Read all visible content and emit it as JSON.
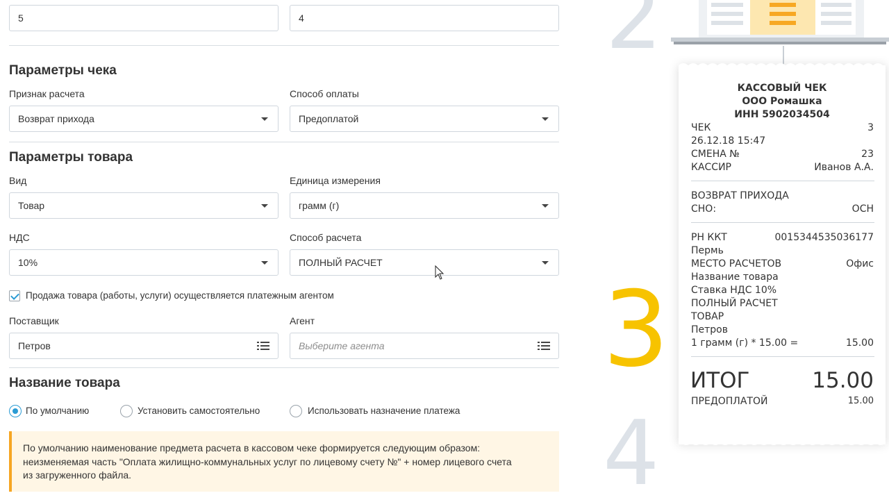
{
  "top_inputs": {
    "left_value": "5",
    "right_value": "4"
  },
  "receipt_params": {
    "heading": "Параметры чека",
    "calc_sign_label": "Признак расчета",
    "calc_sign_value": "Возврат прихода",
    "payment_method_label": "Способ оплаты",
    "payment_method_value": "Предоплатой"
  },
  "product_params": {
    "heading": "Параметры товара",
    "kind_label": "Вид",
    "kind_value": "Товар",
    "unit_label": "Единица измерения",
    "unit_value": "грамм (г)",
    "vat_label": "НДС",
    "vat_value": "10%",
    "calc_method_label": "Способ расчета",
    "calc_method_value": "ПОЛНЫЙ РАСЧЕТ",
    "agent_checkbox_label": "Продажа товара (работы, услуги) осуществляется платежным агентом",
    "supplier_label": "Поставщик",
    "supplier_value": "Петров",
    "agent_label": "Агент",
    "agent_placeholder": "Выберите агента"
  },
  "product_name": {
    "heading": "Название товара",
    "options": [
      "По умолчанию",
      "Установить самостоятельно",
      "Использовать назначение платежа"
    ],
    "selected": "По умолчанию",
    "info_lines": [
      "По умолчанию наименование предмета расчета в кассовом чеке формируется следующим образом:",
      "неизменяемая часть \"Оплата жилищно-коммунальных услуг по лицевому счету №\" + номер лицевого счета",
      "из загруженного файла."
    ]
  },
  "steps": {
    "step2": "2",
    "step3": "3",
    "step4": "4"
  },
  "receipt": {
    "title": "КАССОВЫЙ ЧЕК",
    "company": "ООО Ромашка",
    "inn": "ИНН 5902034504",
    "check_label": "ЧЕК",
    "check_value": "3",
    "datetime": "26.12.18 15:47",
    "shift_label": "СМЕНА №",
    "shift_value": "23",
    "cashier_label": "КАССИР",
    "cashier_value": "Иванов А.А.",
    "operation": "ВОЗВРАТ ПРИХОДА",
    "tax_label": "СНО:",
    "tax_value": "ОСН",
    "kkt_label": "РН ККТ",
    "kkt_value": "0015344535036177",
    "city": "Пермь",
    "place_label": "МЕСТО РАСЧЕТОВ",
    "place_value": "Офис",
    "item_name": "Название товара",
    "vat_rate": "Ставка НДС 10%",
    "calc_method": "ПОЛНЫЙ РАСЧЕТ",
    "subject": "ТОВАР",
    "supplier": "Петров",
    "line_calc": "1 грамм (г) * 15.00 =",
    "line_total": "15.00",
    "total_label": "ИТОГ",
    "total_value": "15.00",
    "prepay_label": "ПРЕДОПЛАТОЙ",
    "prepay_value": "15.00"
  },
  "colors": {
    "accent": "#2a9bd4",
    "step3": "#f7c300",
    "step_muted": "#dde2e8",
    "info_border": "#f6a623"
  }
}
